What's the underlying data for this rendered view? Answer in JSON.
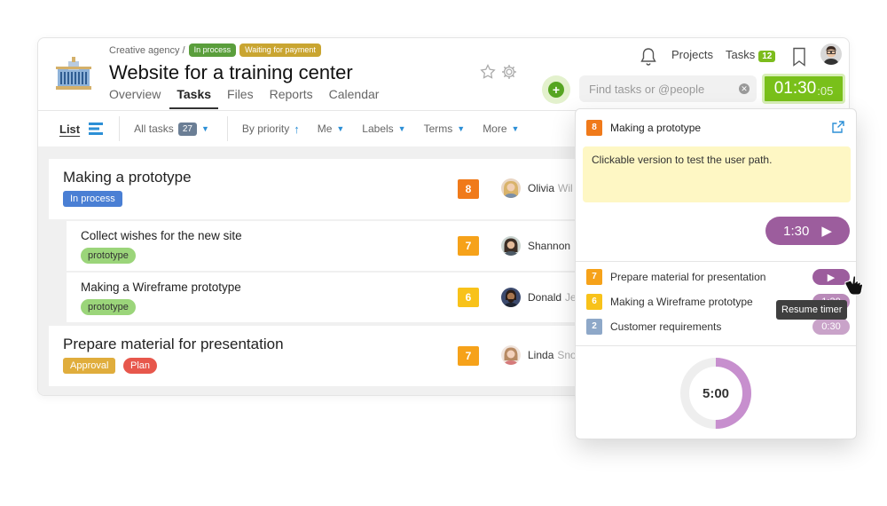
{
  "header": {
    "breadcrumb": "Creative agency /",
    "badges": [
      {
        "label": "In process",
        "color": "#5a9e3c"
      },
      {
        "label": "Waiting for payment",
        "color": "#c9a531"
      }
    ],
    "title": "Website for a training center",
    "tabs": [
      "Overview",
      "Tasks",
      "Files",
      "Reports",
      "Calendar"
    ],
    "active_tab": "Tasks",
    "nav": {
      "projects": "Projects",
      "tasks": "Tasks",
      "tasks_count": "12"
    },
    "search_placeholder": "Find tasks or @people",
    "timer": {
      "main": "01:30",
      "seconds": ":05"
    }
  },
  "toolbar": {
    "view": "List",
    "all_tasks": "All tasks",
    "all_tasks_count": "27",
    "sort": "By priority",
    "me": "Me",
    "labels": "Labels",
    "terms": "Terms",
    "more": "More"
  },
  "tasks": [
    {
      "title": "Making a prototype",
      "tag": "In process",
      "tag_color": "#4a7fd4",
      "priority": "8",
      "priority_color": "#f07a1a",
      "person": "Olivia",
      "surname": "Wil"
    },
    {
      "title": "Collect wishes for the new site",
      "tag": "prototype",
      "tag_color": "#9bd57a",
      "priority": "7",
      "priority_color": "#f6a21a",
      "person": "Shannon",
      "surname": ""
    },
    {
      "title": "Making a Wireframe prototype",
      "tag": "prototype",
      "tag_color": "#9bd57a",
      "priority": "6",
      "priority_color": "#f8c21a",
      "person": "Donald",
      "surname": "Je"
    },
    {
      "title": "Prepare material for presentation",
      "tags": [
        {
          "label": "Approval",
          "color": "#e0ad3c"
        },
        {
          "label": "Plan",
          "color": "#e7574c"
        }
      ],
      "priority": "7",
      "priority_color": "#f6a21a",
      "person": "Linda",
      "surname": "Sno"
    }
  ],
  "panel": {
    "task_number": "8",
    "task_number_color": "#f07a1a",
    "task_title": "Making a prototype",
    "note": "Clickable version to test the user path.",
    "timer": "1:30",
    "queue": [
      {
        "num": "7",
        "color": "#f6a21a",
        "title": "Prepare material for presentation",
        "time": "",
        "btn_color": "#9c5d9d"
      },
      {
        "num": "6",
        "color": "#f8c21a",
        "title": "Making a Wireframe prototype",
        "time": "1:30",
        "btn_color": "#b98ab9"
      },
      {
        "num": "2",
        "color": "#8ea8c8",
        "title": "Customer requirements",
        "time": "0:30",
        "btn_color": "#c9a3c9"
      }
    ],
    "tooltip": "Resume timer",
    "pomodoro": "5:00",
    "pomodoro_progress": 0.5
  }
}
